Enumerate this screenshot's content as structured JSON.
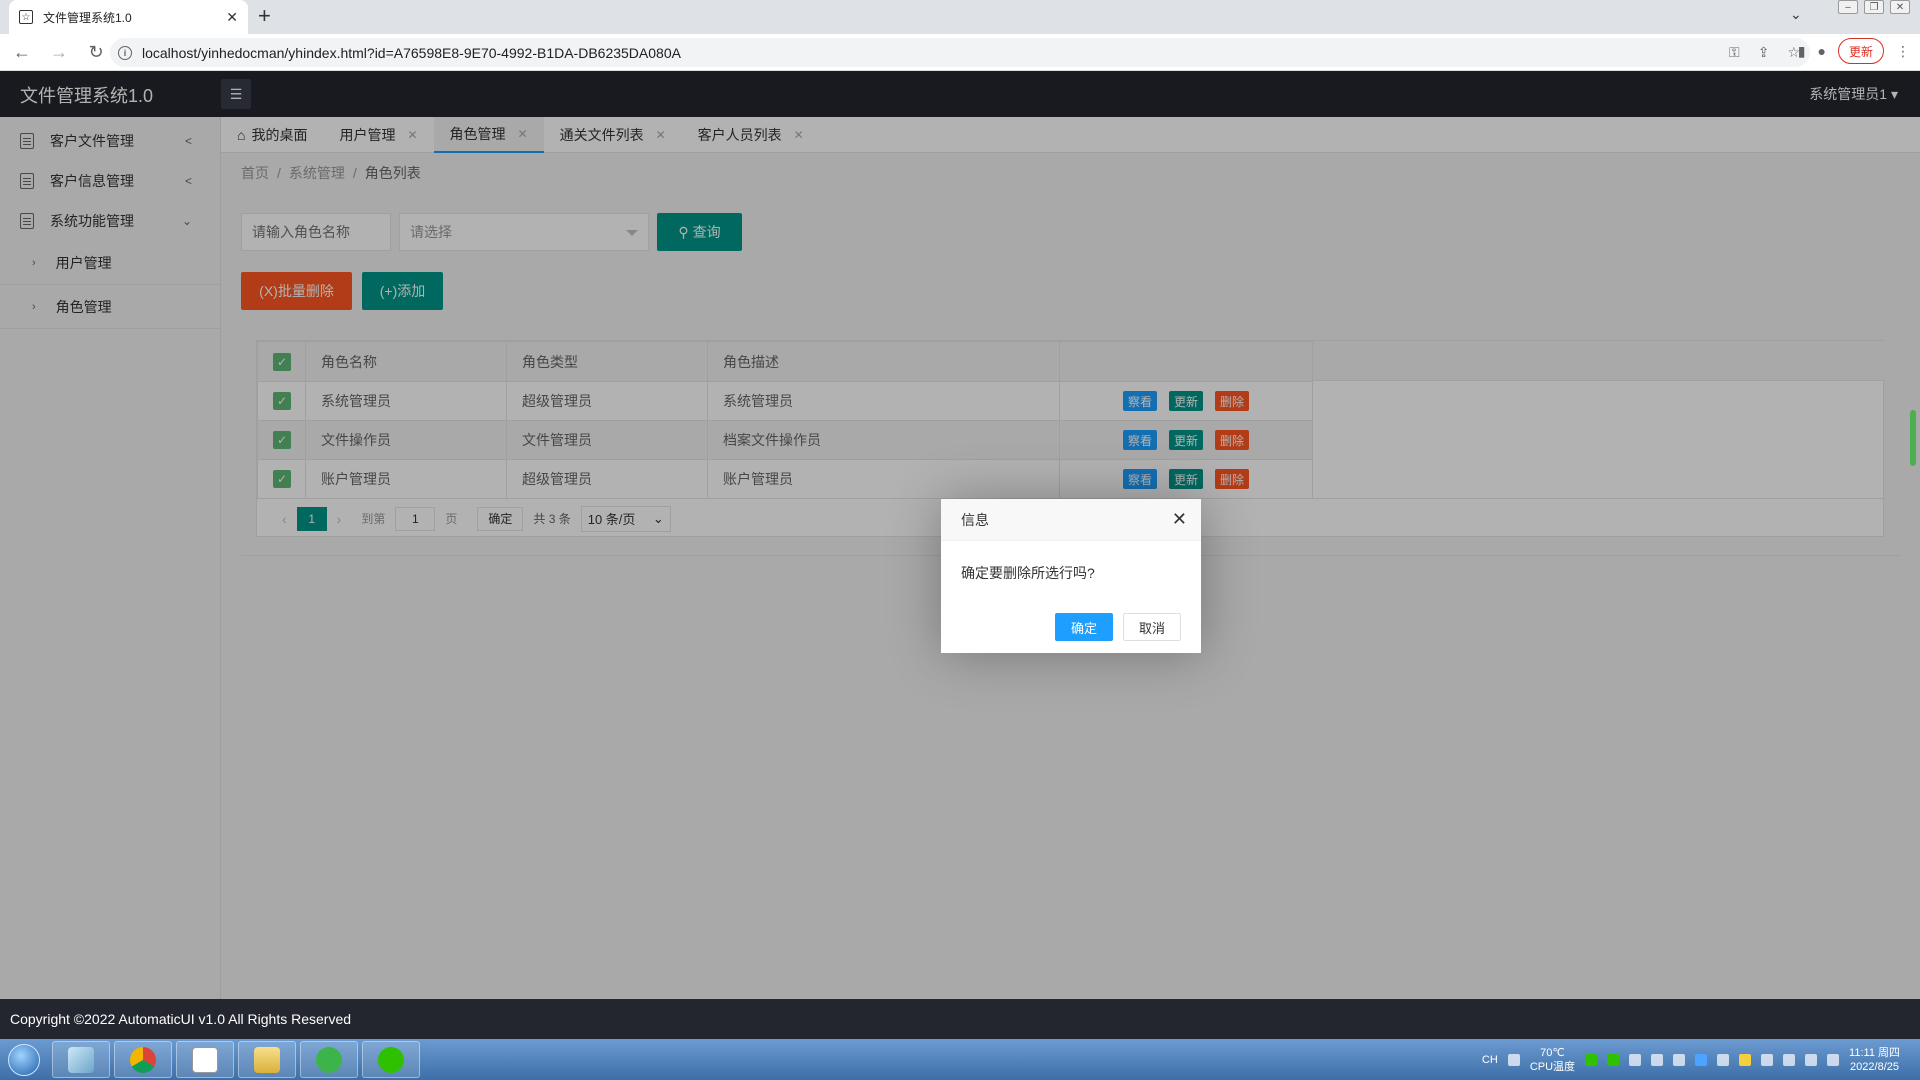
{
  "browser": {
    "tab_title": "文件管理系统1.0",
    "url": "localhost/yinhedocman/yhindex.html?id=A76598E8-9E70-4992-B1DA-DB6235DA080A",
    "update_label": "更新"
  },
  "header": {
    "title": "文件管理系统1.0",
    "user": "系统管理员1"
  },
  "sidebar": {
    "items": [
      {
        "label": "客户文件管理"
      },
      {
        "label": "客户信息管理"
      },
      {
        "label": "系统功能管理"
      }
    ],
    "subitems": [
      {
        "label": "用户管理"
      },
      {
        "label": "角色管理"
      }
    ]
  },
  "tabs": [
    {
      "label": "我的桌面"
    },
    {
      "label": "用户管理"
    },
    {
      "label": "角色管理"
    },
    {
      "label": "通关文件列表"
    },
    {
      "label": "客户人员列表"
    }
  ],
  "breadcrumb": {
    "home": "首页",
    "section": "系统管理",
    "current": "角色列表",
    "sep": "/"
  },
  "search": {
    "placeholder": "请输入角色名称",
    "select_placeholder": "请选择",
    "query_label": "查询"
  },
  "actions": {
    "batch_delete": "(X)批量删除",
    "add": "(+)添加"
  },
  "table": {
    "headers": [
      "角色名称",
      "角色类型",
      "角色描述"
    ],
    "rows": [
      {
        "name": "系统管理员",
        "type": "超级管理员",
        "desc": "系统管理员"
      },
      {
        "name": "文件操作员",
        "type": "文件管理员",
        "desc": "档案文件操作员"
      },
      {
        "name": "账户管理员",
        "type": "超级管理员",
        "desc": "账户管理员"
      }
    ],
    "ops": {
      "view": "察看",
      "update": "更新",
      "delete": "删除"
    }
  },
  "pager": {
    "current": "1",
    "goto_label": "到第",
    "page_input": "1",
    "page_unit": "页",
    "confirm": "确定",
    "total": "共 3 条",
    "page_size": "10 条/页"
  },
  "dialog": {
    "title": "信息",
    "message": "确定要删除所选行吗?",
    "ok": "确定",
    "cancel": "取消"
  },
  "footer": {
    "copyright": "Copyright ©2022 AutomaticUI v1.0 All Rights Reserved"
  },
  "taskbar": {
    "lang": "CH",
    "temp": "70℃",
    "temp_label": "CPU温度",
    "time": "11:11 周四",
    "date": "2022/8/25"
  },
  "colors": {
    "header_bg": "#23262e",
    "primary": "#009688",
    "danger": "#ff5722",
    "info": "#1e9fff",
    "check": "#5fb878"
  }
}
